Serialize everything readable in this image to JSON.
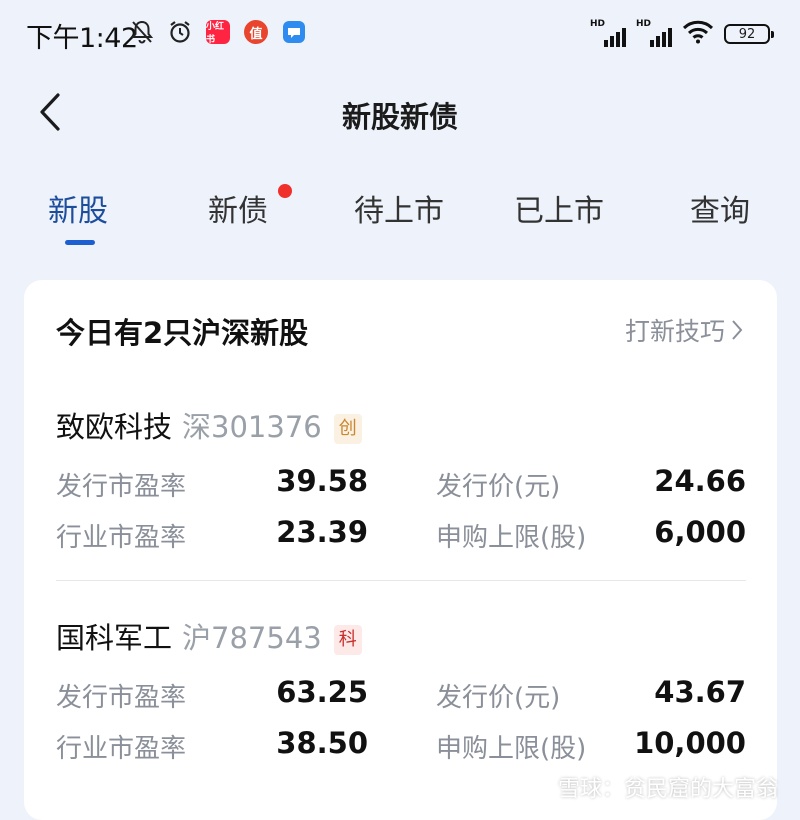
{
  "status_bar": {
    "time": "下午1:42",
    "left_icons": [
      "bell-off-icon",
      "alarm-icon",
      "xiaohongshu-app-icon",
      "zhide-app-icon",
      "message-app-icon"
    ],
    "app_badges": {
      "xiaohongshu": "小红书",
      "zhide": "值"
    },
    "signal_labels": [
      "HD",
      "HD"
    ],
    "battery": "92"
  },
  "header": {
    "title": "新股新债",
    "back_icon": "back-chevron-icon"
  },
  "tabs": [
    {
      "label": "新股",
      "active": true
    },
    {
      "label": "新债",
      "has_dot": true
    },
    {
      "label": "待上市"
    },
    {
      "label": "已上市"
    },
    {
      "label": "查询"
    }
  ],
  "card": {
    "title": "今日有2只沪深新股",
    "tips_link": "打新技巧",
    "stocks": [
      {
        "name": "致欧科技",
        "code": "深301376",
        "board_tag": "创",
        "metrics": {
          "issue_pe_label": "发行市盈率",
          "issue_pe": "39.58",
          "industry_pe_label": "行业市盈率",
          "industry_pe": "23.39",
          "issue_price_label": "发行价(元)",
          "issue_price": "24.66",
          "sub_limit_label": "申购上限(股)",
          "sub_limit": "6,000"
        }
      },
      {
        "name": "国科军工",
        "code": "沪787543",
        "board_tag": "科",
        "metrics": {
          "issue_pe_label": "发行市盈率",
          "issue_pe": "63.25",
          "industry_pe_label": "行业市盈率",
          "industry_pe": "38.50",
          "issue_price_label": "发行价(元)",
          "issue_price": "43.67",
          "sub_limit_label": "申购上限(股)",
          "sub_limit": "10,000"
        }
      }
    ]
  },
  "watermark": "雪球：贫民窟的大富翁",
  "colors": {
    "accent": "#1d5fd0",
    "active_tab": "#1d4e9e",
    "dot": "#f0302b",
    "bg": "#eef3fb"
  }
}
